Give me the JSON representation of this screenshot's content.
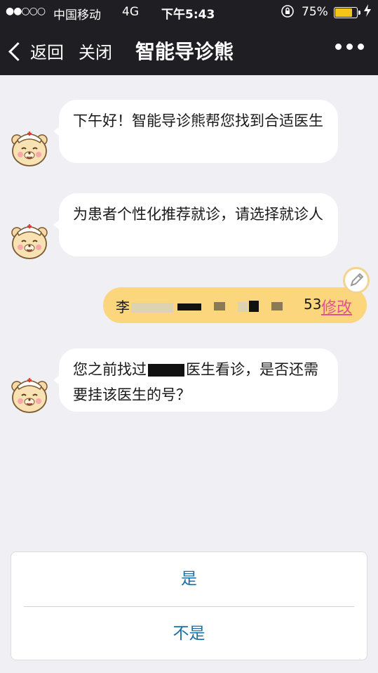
{
  "status_bar": {
    "signal": "●●○○○",
    "carrier": "中国移动",
    "network": "4G",
    "time": "下午5:43",
    "battery_percent": "75%",
    "battery_level": 0.75,
    "lock_icon": "orientation-lock-icon",
    "charge_icon": "bolt-icon"
  },
  "nav": {
    "back_label": "返回",
    "close_label": "关闭",
    "title": "智能导诊熊",
    "more_icon": "ellipsis-icon"
  },
  "messages": [
    {
      "sender": "bot",
      "text": "下午好！智能导诊熊帮您找到合适医生"
    },
    {
      "sender": "bot",
      "text": "为患者个性化推荐就诊，请选择就诊人"
    },
    {
      "sender": "user",
      "name_visible": "李",
      "tail_visible": "53",
      "edit_label": "修改"
    },
    {
      "sender": "bot",
      "text_before": "您之前找过",
      "text_after": "医生看诊，是否还需要挂该医生的号？"
    }
  ],
  "options": {
    "yes_label": "是",
    "no_label": "不是"
  },
  "colors": {
    "header_bg": "#1f1f23",
    "page_bg": "#efeff4",
    "user_bubble": "#fcd67c",
    "edit_link": "#e05393",
    "option_text": "#1c6fa6",
    "battery_fill": "#f5c518"
  }
}
